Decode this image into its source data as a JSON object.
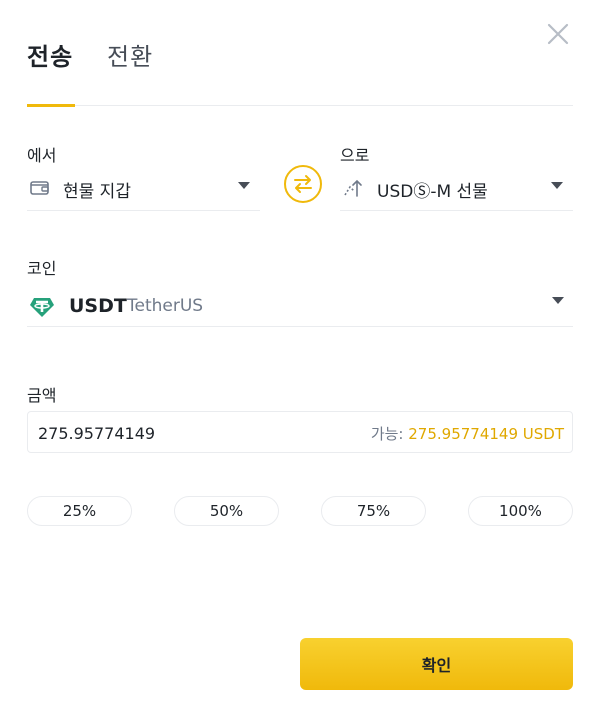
{
  "header": {
    "tabs": [
      {
        "label": "전송",
        "active": true
      },
      {
        "label": "전환",
        "active": false
      }
    ],
    "close_icon": "close-icon"
  },
  "from": {
    "label": "에서",
    "value": "현물 지갑",
    "icon": "wallet-icon"
  },
  "swap_icon": "swap-arrows-icon",
  "to": {
    "label": "으로",
    "value": "USDⓈ-M 선물",
    "icon": "futures-icon"
  },
  "coin": {
    "label": "코인",
    "symbol": "USDT",
    "name": "TetherUS",
    "icon": "tether-icon"
  },
  "amount": {
    "label": "금액",
    "value": "275.95774149",
    "available_label": "가능:",
    "available_value": "275.95774149 USDT"
  },
  "percent_buttons": [
    "25%",
    "50%",
    "75%",
    "100%"
  ],
  "confirm_label": "확인",
  "colors": {
    "accent": "#F0B90B",
    "text": "#1E2329",
    "muted": "#707A8A",
    "tether": "#26A17B"
  }
}
